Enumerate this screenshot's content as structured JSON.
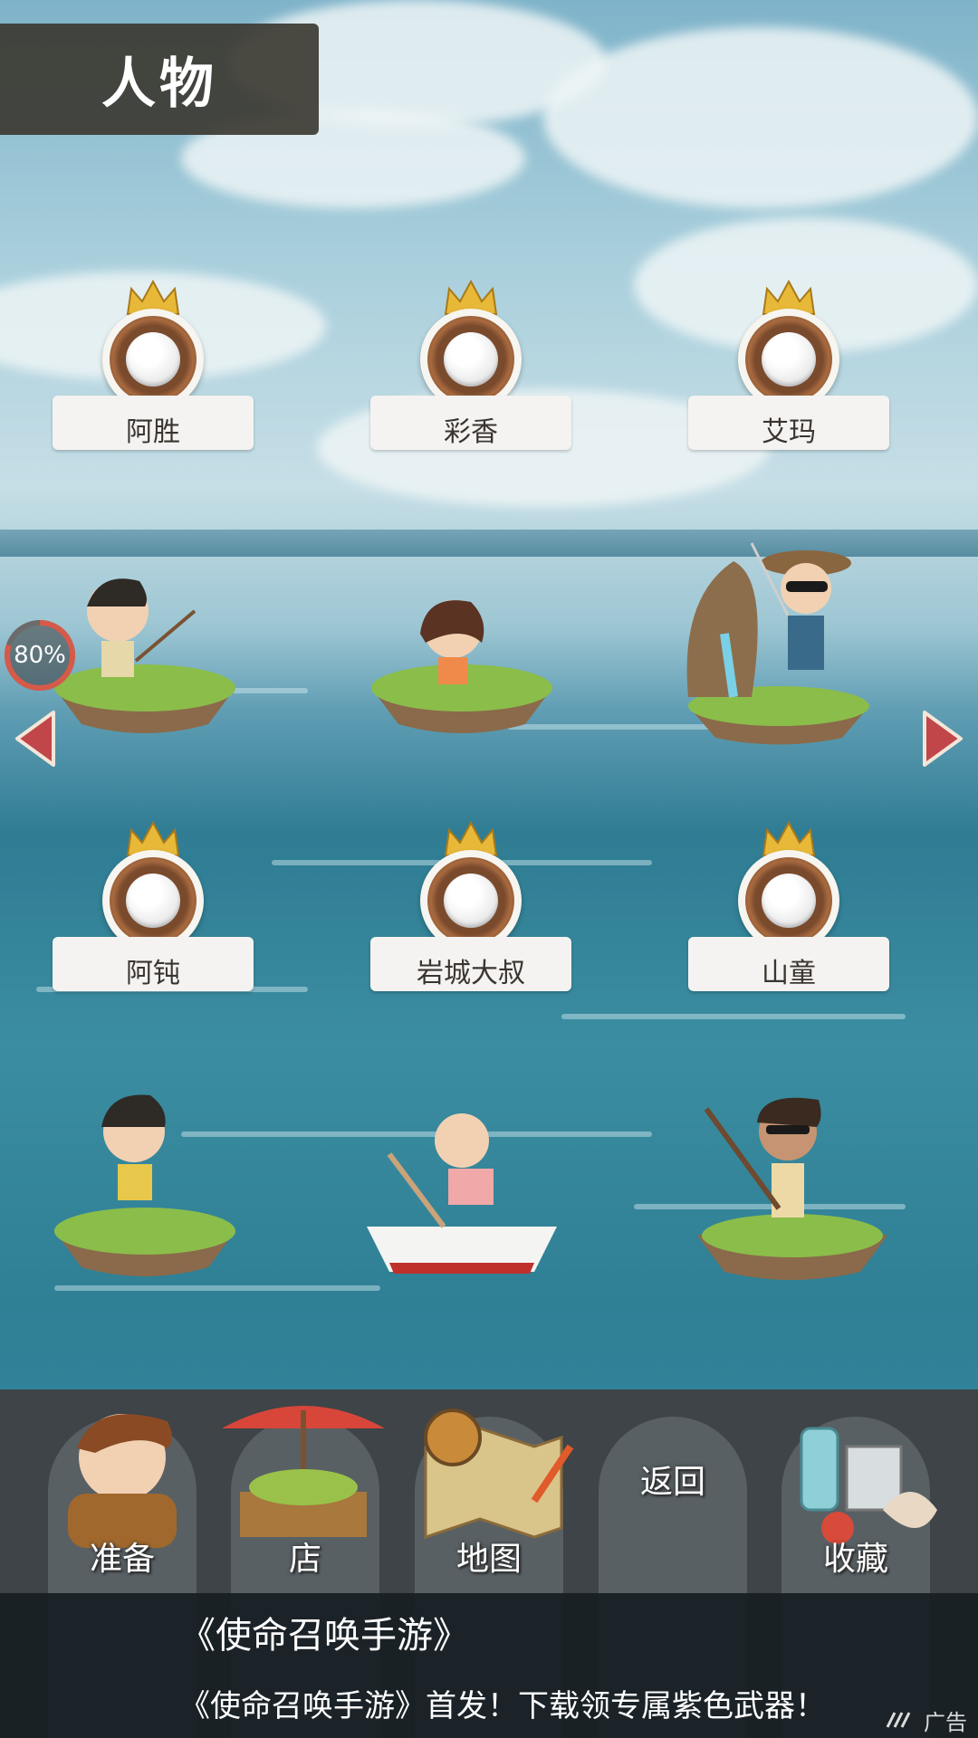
{
  "header": {
    "title": "人物"
  },
  "characters": [
    {
      "name": "阿胜"
    },
    {
      "name": "彩香"
    },
    {
      "name": "艾玛"
    },
    {
      "name": "阿钝"
    },
    {
      "name": "岩城大叔"
    },
    {
      "name": "山童"
    }
  ],
  "progress": {
    "value": 0.8,
    "label": "80%"
  },
  "nav": {
    "items": [
      {
        "label": "准备",
        "icon": "boy-with-bag-icon"
      },
      {
        "label": "店",
        "icon": "market-stall-icon"
      },
      {
        "label": "地图",
        "icon": "map-compass-icon"
      },
      {
        "label": "返回",
        "icon": ""
      },
      {
        "label": "收藏",
        "icon": "bottles-shells-icon"
      }
    ]
  },
  "ad": {
    "title": "《使命召唤手游》",
    "description": "《使命召唤手游》首发！下载领专属紫色武器！",
    "badge": "广告"
  },
  "colors": {
    "header_bg": "#3c3932",
    "medal_ring": "#7a4a2d",
    "crown": "#e8b838",
    "arrow": "#c0464a",
    "bottom_bar": "#3e4447"
  }
}
